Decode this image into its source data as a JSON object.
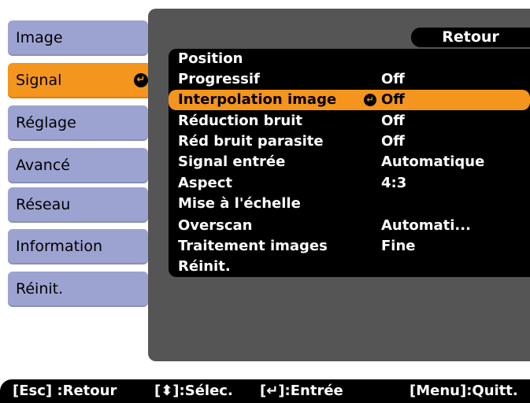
{
  "tabs": [
    {
      "label": "Image"
    },
    {
      "label": "Signal",
      "active": true
    },
    {
      "label": "Réglage"
    },
    {
      "label": "Avancé"
    },
    {
      "label": "Réseau"
    },
    {
      "label": "Information"
    },
    {
      "label": "Réinit."
    }
  ],
  "back_label": "Retour",
  "menu": [
    {
      "label": "Position",
      "value": ""
    },
    {
      "label": "Progressif",
      "value": "Off"
    },
    {
      "label": "Interpolation image",
      "value": "Off",
      "selected": true
    },
    {
      "label": "Réduction bruit",
      "value": "Off"
    },
    {
      "label": "Réd bruit parasite",
      "value": "Off"
    },
    {
      "label": "Signal entrée",
      "value": "Automatique"
    },
    {
      "label": "Aspect",
      "value": "4:3"
    },
    {
      "label": "Mise à l'échelle",
      "value": ""
    },
    {
      "label": "Overscan",
      "value": "Automati..."
    },
    {
      "label": "Traitement images",
      "value": "Fine"
    },
    {
      "label": "Réinit.",
      "value": ""
    }
  ],
  "help": {
    "esc": "[Esc] :Retour",
    "select": "[⬍]:Sélec.",
    "enter": "[↵]:Entrée",
    "menu": "[Menu]:Quitt."
  },
  "enter_icon": "↵",
  "colors": {
    "accent": "#f4951e",
    "tab": "#9da3d1",
    "panel": "#555555",
    "list": "#000000"
  }
}
